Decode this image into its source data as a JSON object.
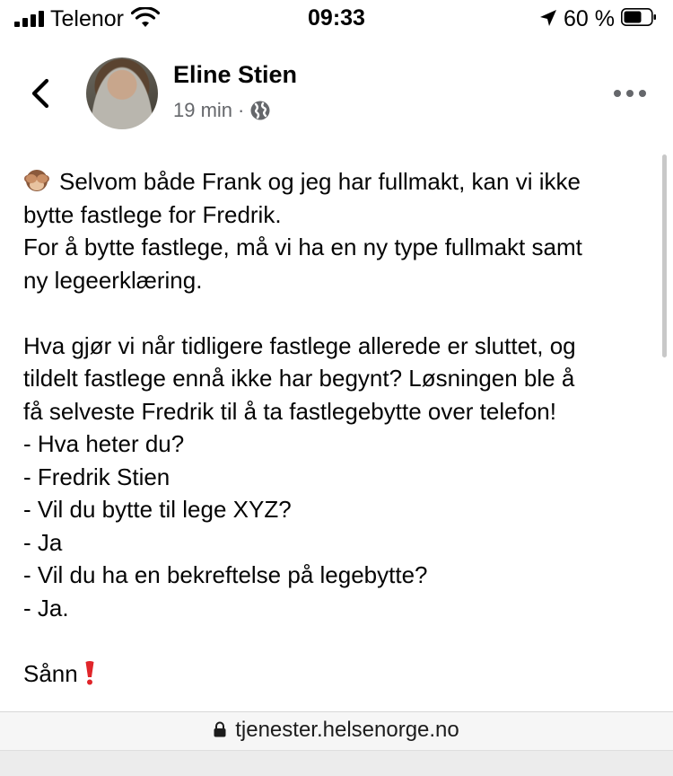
{
  "status_bar": {
    "carrier": "Telenor",
    "time": "09:33",
    "battery": "60 %"
  },
  "post": {
    "author": "Eline Stien",
    "time_ago": "19 min",
    "separator": "·",
    "lines": {
      "p1_line1": "Selvom både Frank og jeg har fullmakt, kan vi ikke",
      "p1_line2": "bytte fastlege for Fredrik.",
      "p1_line3": "For å bytte fastlege, må vi ha en ny type fullmakt samt",
      "p1_line4": "ny legeerklæring.",
      "p2_line1": "Hva gjør vi når tidligere fastlege allerede er sluttet, og",
      "p2_line2": "tildelt fastlege ennå ikke har begynt? Løsningen ble å",
      "p2_line3": "få selveste Fredrik til å ta fastlegebytte over telefon!",
      "p2_line4": "- Hva heter du?",
      "p2_line5": "- Fredrik Stien",
      "p2_line6": "- Vil du bytte til lege XYZ?",
      "p2_line7": "- Ja",
      "p2_line8": "- Vil du ha en bekreftelse på legebytte?",
      "p2_line9": "- Ja.",
      "p3_line1": "Sånn"
    }
  },
  "url_bar": {
    "url": "tjenester.helsenorge.no"
  },
  "icons": {
    "monkey": "see-no-evil-monkey-emoji",
    "exclamation": "red-exclamation-emoji",
    "globe": "globe-icon"
  },
  "colors": {
    "text": "#050505",
    "secondary": "#65676b",
    "exclamation": "#e0252a"
  }
}
